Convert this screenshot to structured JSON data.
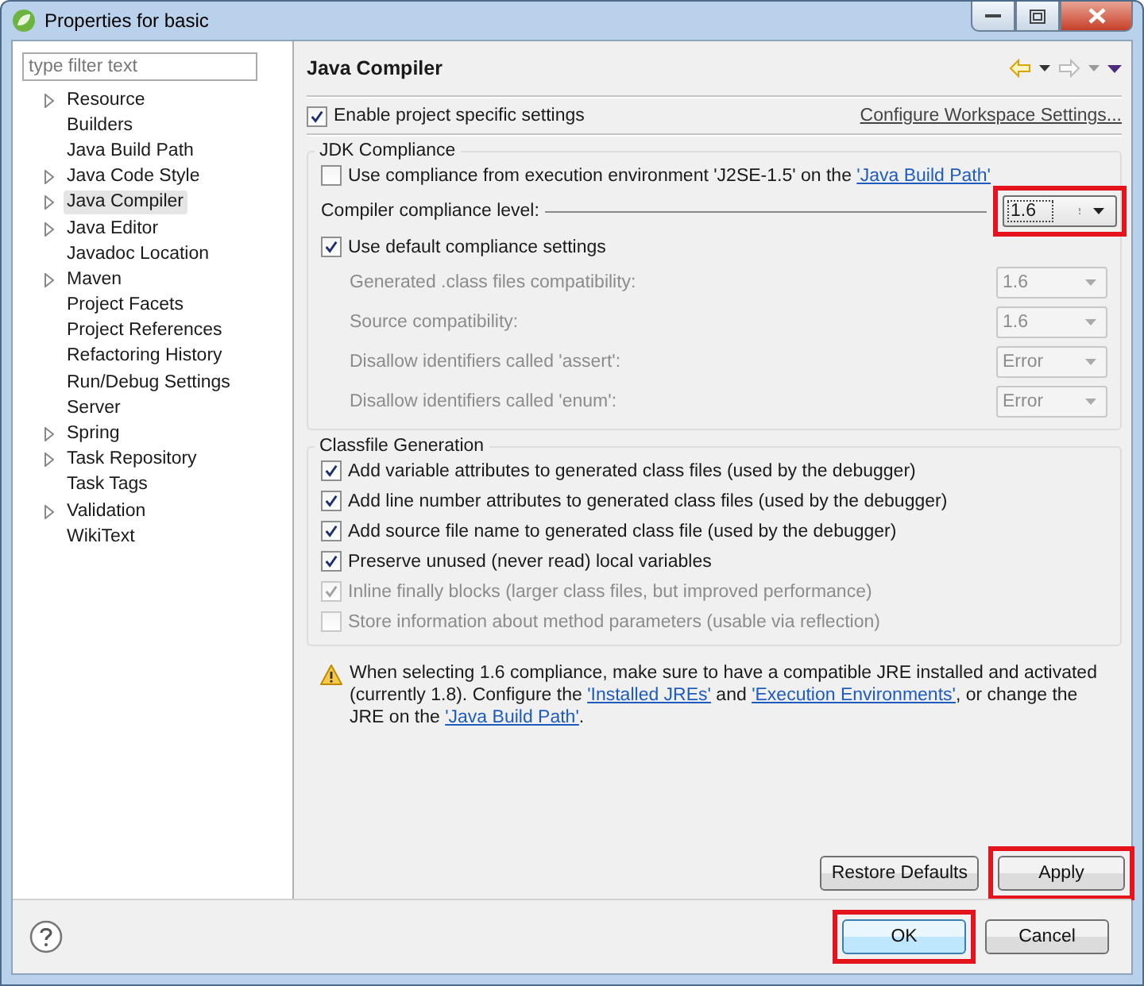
{
  "window": {
    "title": "Properties for basic"
  },
  "filter": {
    "placeholder": "type filter text"
  },
  "tree": [
    {
      "label": "Resource",
      "expandable": true,
      "selected": false
    },
    {
      "label": "Builders",
      "expandable": false,
      "selected": false
    },
    {
      "label": "Java Build Path",
      "expandable": false,
      "selected": false
    },
    {
      "label": "Java Code Style",
      "expandable": true,
      "selected": false
    },
    {
      "label": "Java Compiler",
      "expandable": true,
      "selected": true
    },
    {
      "label": "Java Editor",
      "expandable": true,
      "selected": false
    },
    {
      "label": "Javadoc Location",
      "expandable": false,
      "selected": false
    },
    {
      "label": "Maven",
      "expandable": true,
      "selected": false
    },
    {
      "label": "Project Facets",
      "expandable": false,
      "selected": false
    },
    {
      "label": "Project References",
      "expandable": false,
      "selected": false
    },
    {
      "label": "Refactoring History",
      "expandable": false,
      "selected": false
    },
    {
      "label": "Run/Debug Settings",
      "expandable": false,
      "selected": false
    },
    {
      "label": "Server",
      "expandable": false,
      "selected": false
    },
    {
      "label": "Spring",
      "expandable": true,
      "selected": false
    },
    {
      "label": "Task Repository",
      "expandable": true,
      "selected": false
    },
    {
      "label": "Task Tags",
      "expandable": false,
      "selected": false
    },
    {
      "label": "Validation",
      "expandable": true,
      "selected": false
    },
    {
      "label": "WikiText",
      "expandable": false,
      "selected": false
    }
  ],
  "page": {
    "title": "Java Compiler",
    "enable_specific": {
      "label": "Enable project specific settings",
      "checked": true
    },
    "configure_link": "Configure Workspace Settings..."
  },
  "jdk": {
    "title": "JDK Compliance",
    "use_env": {
      "checked": false,
      "parts": [
        {
          "kind": "text",
          "text": "Use compliance from execution environment 'J2SE-1.5' on the "
        },
        {
          "kind": "link",
          "text": "'Java Build Path'"
        }
      ]
    },
    "level": {
      "label": "Compiler compliance level:",
      "value": "1.6",
      "highlighted": true
    },
    "use_default": {
      "label": "Use default compliance settings",
      "checked": true
    },
    "settings": [
      {
        "label": "Generated .class files compatibility:",
        "value": "1.6",
        "disabled": true
      },
      {
        "label": "Source compatibility:",
        "value": "1.6",
        "disabled": true
      },
      {
        "label": "Disallow identifiers called 'assert':",
        "value": "Error",
        "disabled": true
      },
      {
        "label": "Disallow identifiers called 'enum':",
        "value": "Error",
        "disabled": true
      }
    ]
  },
  "classfile": {
    "title": "Classfile Generation",
    "options": [
      {
        "label": "Add variable attributes to generated class files (used by the debugger)",
        "checked": true,
        "disabled": false
      },
      {
        "label": "Add line number attributes to generated class files (used by the debugger)",
        "checked": true,
        "disabled": false
      },
      {
        "label": "Add source file name to generated class file (used by the debugger)",
        "checked": true,
        "disabled": false
      },
      {
        "label": "Preserve unused (never read) local variables",
        "checked": true,
        "disabled": false
      },
      {
        "label": "Inline finally blocks (larger class files, but improved performance)",
        "checked": true,
        "disabled": true
      },
      {
        "label": "Store information about method parameters (usable via reflection)",
        "checked": false,
        "disabled": true
      }
    ]
  },
  "warning": {
    "parts": [
      {
        "kind": "text",
        "text": "When selecting 1.6 compliance, make sure to have a compatible JRE installed and activated (currently 1.8). Configure the "
      },
      {
        "kind": "link",
        "text": "'Installed JREs'"
      },
      {
        "kind": "text",
        "text": " and "
      },
      {
        "kind": "link",
        "text": "'Execution Environments'"
      },
      {
        "kind": "text",
        "text": ", or change the JRE on the "
      },
      {
        "kind": "link",
        "text": "'Java Build Path'"
      },
      {
        "kind": "text",
        "text": "."
      }
    ]
  },
  "buttons": [
    {
      "label": "Restore Defaults",
      "highlighted": false
    },
    {
      "label": "Apply",
      "highlighted": true
    }
  ],
  "dialog_buttons": [
    {
      "label": "OK",
      "highlighted": true,
      "default": true
    },
    {
      "label": "Cancel",
      "highlighted": false,
      "default": false
    }
  ]
}
